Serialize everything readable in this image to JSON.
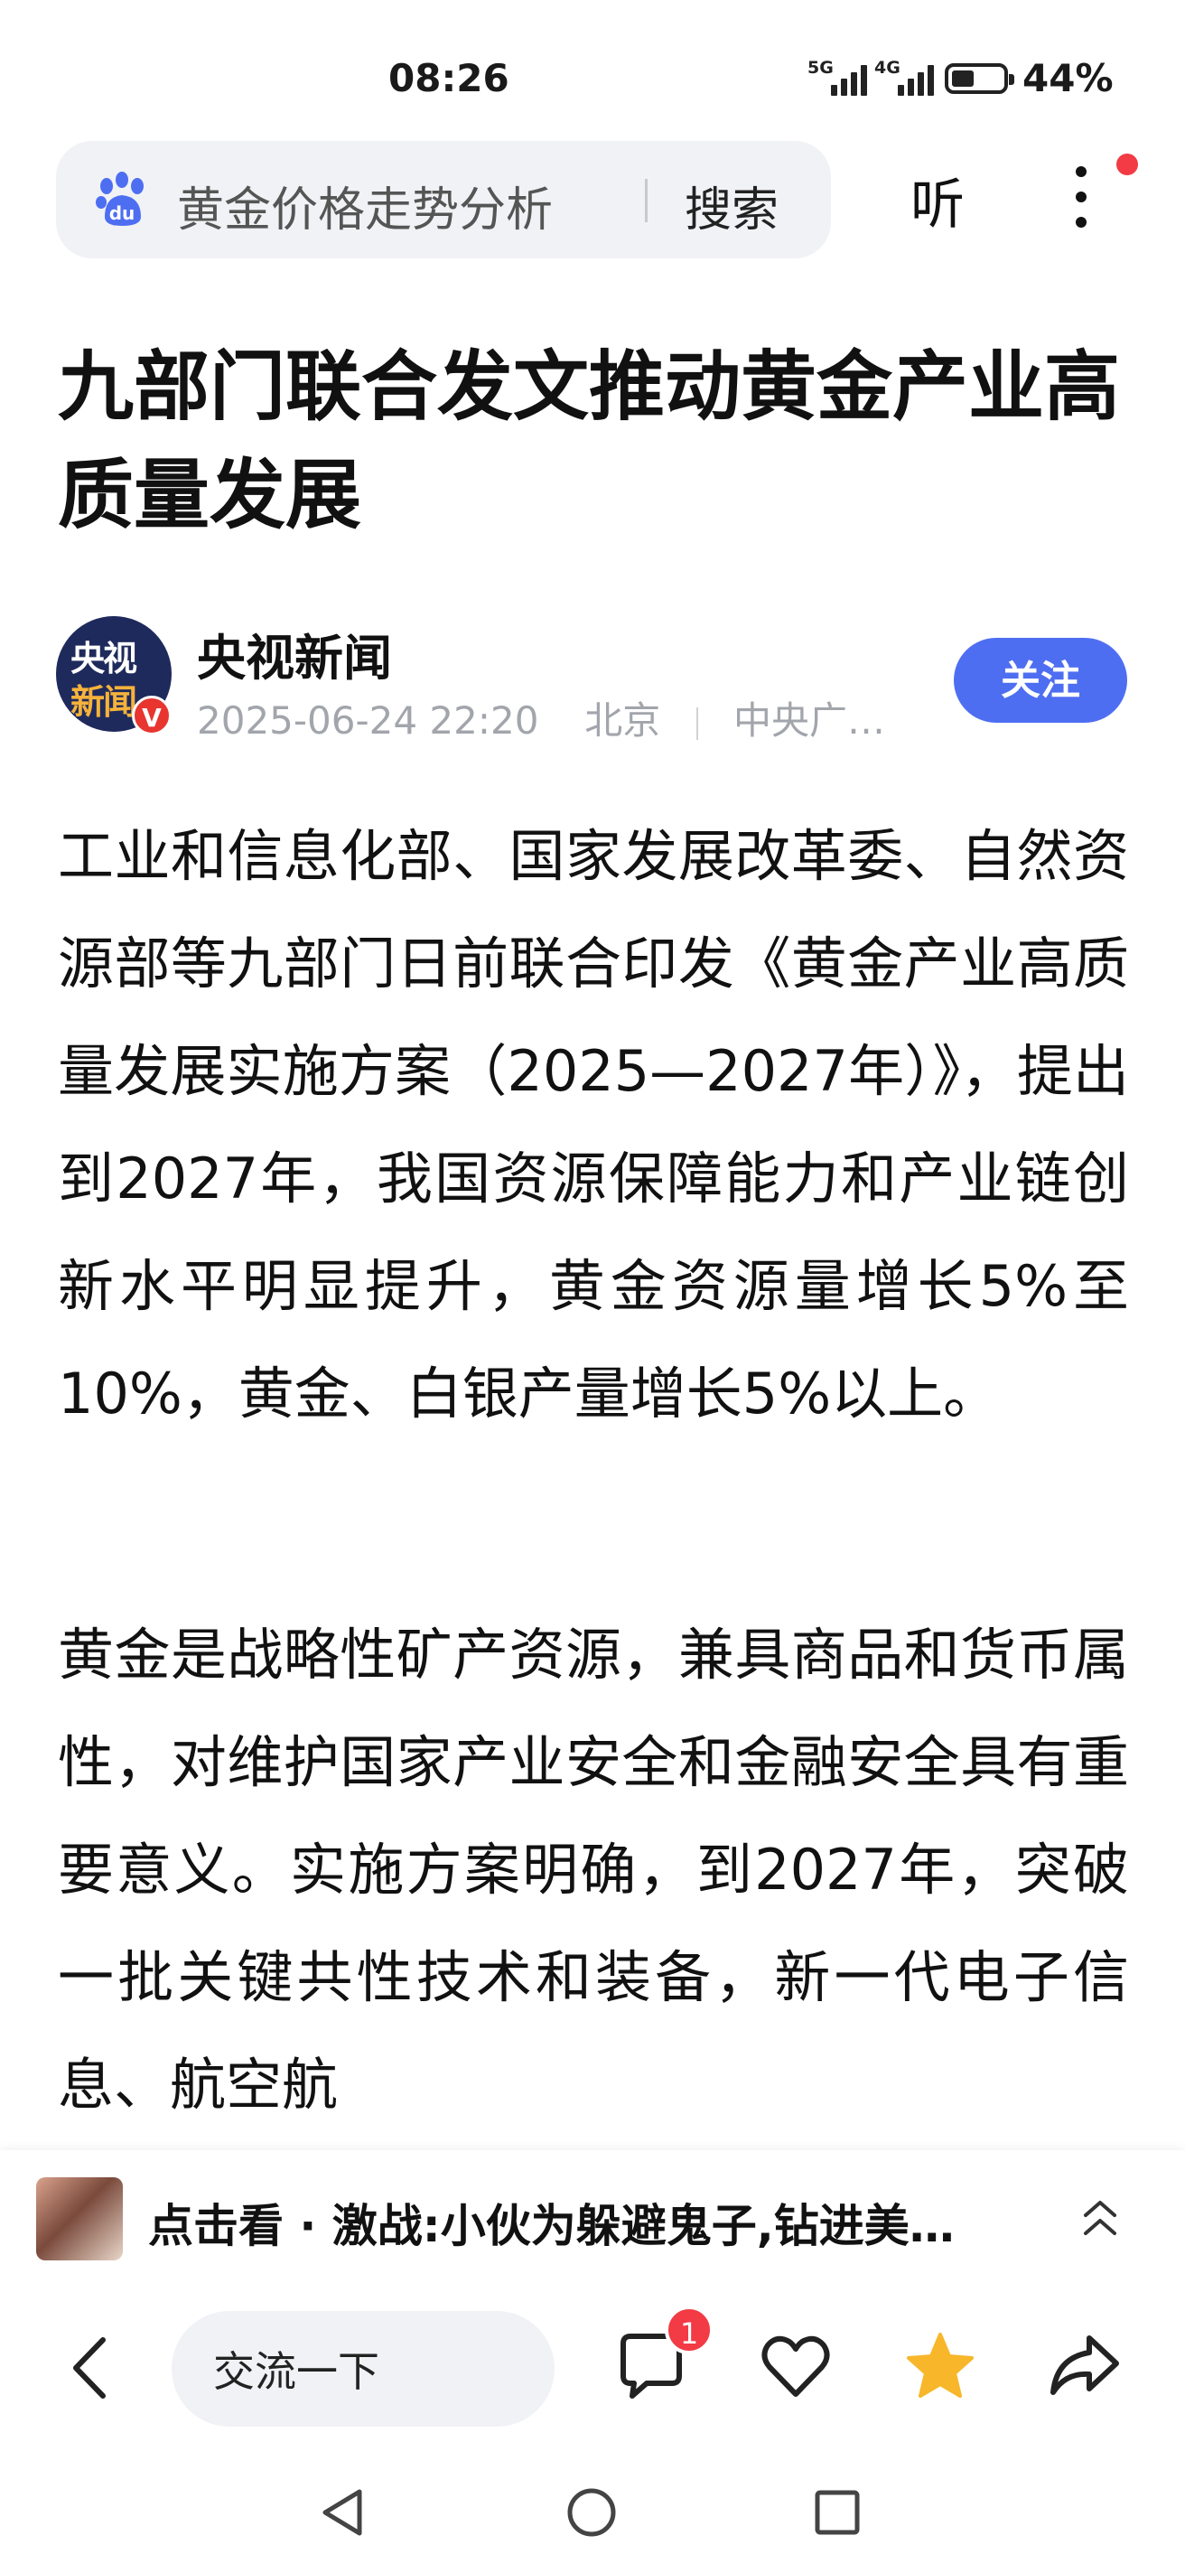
{
  "status_bar": {
    "time": "08:26",
    "signal_1_label": "5G",
    "signal_2_label": "4G",
    "battery_level_percent": 44,
    "battery_text": "44%"
  },
  "header": {
    "search_query": "黄金价格走势分析",
    "search_button": "搜索",
    "listen_label": "听",
    "notification_dot_color": "#f23b45"
  },
  "article": {
    "title": "九部门联合发文推动黄金产业高质量发展",
    "author": {
      "name": "央视新闻",
      "avatar_line1": "央视",
      "avatar_line2": "新闻",
      "verified_mark": "V",
      "date": "2025-06-24 22:20",
      "location": "北京",
      "source": "中央广…"
    },
    "follow_label": "关注",
    "paragraphs": [
      "工业和信息化部、国家发展改革委、自然资源部等九部门日前联合印发《黄金产业高质量发展实施方案（2025—2027年）》，提出到2027年，我国资源保障能力和产业链创新水平明显提升，黄金资源量增长5%至10%，黄金、白银产量增长5%以上。",
      "黄金是战略性矿产资源，兼具商品和货币属性，对维护国家产业安全和金融安全具有重要意义。实施方案明确，到2027年，突破一批关键共性技术和装备，新一代电子信息、航空航"
    ]
  },
  "video_bar": {
    "text": "点击看 · 激战:小伙为躲避鬼子,钻进美…"
  },
  "bottom_bar": {
    "comment_placeholder": "交流一下",
    "comment_badge": "1",
    "accent_color": "#4e6ef2",
    "favorite_color": "#f8b62a"
  }
}
